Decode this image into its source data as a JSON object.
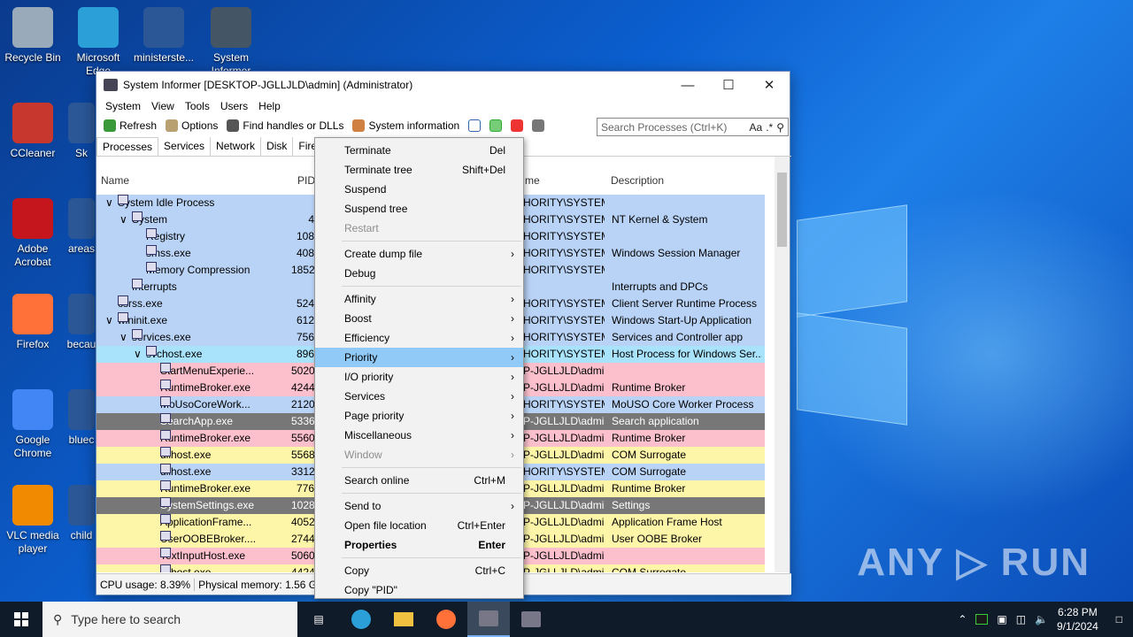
{
  "desktop": {
    "icons": [
      {
        "label": "Recycle Bin",
        "color": "#9ab"
      },
      {
        "label": "Microsoft Edge",
        "color": "#2a9fd8"
      },
      {
        "label": "ministerste...",
        "color": "#2b5797"
      },
      {
        "label": "System Informer",
        "color": "#445566"
      },
      {
        "label": "CCleaner",
        "color": "#c8372d"
      },
      {
        "label": "Adobe Acrobat",
        "color": "#c4161c"
      },
      {
        "label": "Firefox",
        "color": "#ff7139"
      },
      {
        "label": "Google Chrome",
        "color": "#4285f4"
      },
      {
        "label": "VLC media player",
        "color": "#f18a00"
      }
    ],
    "partial_icons": [
      "Sk",
      "areas",
      "becau",
      "bluec",
      "child"
    ],
    "watermark": "ANY ▷ RUN"
  },
  "window": {
    "title": "System Informer [DESKTOP-JGLLJLD\\admin] (Administrator)",
    "menu": [
      "System",
      "View",
      "Tools",
      "Users",
      "Help"
    ],
    "toolbar": {
      "refresh": "Refresh",
      "options": "Options",
      "find": "Find handles or DLLs",
      "sysinfo": "System information"
    },
    "search_placeholder": "Search Processes (Ctrl+K)",
    "search_extra": "Aa",
    "tabs": [
      "Processes",
      "Services",
      "Network",
      "Disk",
      "Fire"
    ],
    "columns": {
      "name": "Name",
      "pid": "PID",
      "user": "me",
      "desc": "Description"
    },
    "rows": [
      {
        "indent": 0,
        "name": "System Idle Process",
        "pid": "",
        "user": "HORITY\\SYSTEM",
        "desc": "",
        "bg": "#b9d3f6",
        "exp": "v"
      },
      {
        "indent": 1,
        "name": "System",
        "pid": "4",
        "user": "HORITY\\SYSTEM",
        "desc": "NT Kernel & System",
        "bg": "#b9d3f6",
        "exp": "v"
      },
      {
        "indent": 2,
        "name": "Registry",
        "pid": "108",
        "user": "HORITY\\SYSTEM",
        "desc": "",
        "bg": "#b9d3f6",
        "exp": ""
      },
      {
        "indent": 2,
        "name": "smss.exe",
        "pid": "408",
        "user": "HORITY\\SYSTEM",
        "desc": "Windows Session Manager",
        "bg": "#b9d3f6",
        "exp": ""
      },
      {
        "indent": 2,
        "name": "Memory Compression",
        "pid": "1852",
        "user": "HORITY\\SYSTEM",
        "desc": "",
        "bg": "#b9d3f6",
        "exp": ""
      },
      {
        "indent": 1,
        "name": "Interrupts",
        "pid": "",
        "user": "",
        "desc": "Interrupts and DPCs",
        "bg": "#b9d3f6",
        "exp": ""
      },
      {
        "indent": 0,
        "name": "csrss.exe",
        "pid": "524",
        "user": "HORITY\\SYSTEM",
        "desc": "Client Server Runtime Process",
        "bg": "#b9d3f6",
        "exp": ""
      },
      {
        "indent": 0,
        "name": "wininit.exe",
        "pid": "612",
        "user": "HORITY\\SYSTEM",
        "desc": "Windows Start-Up Application",
        "bg": "#b9d3f6",
        "exp": "v"
      },
      {
        "indent": 1,
        "name": "services.exe",
        "pid": "756",
        "user": "HORITY\\SYSTEM",
        "desc": "Services and Controller app",
        "bg": "#b9d3f6",
        "exp": "v"
      },
      {
        "indent": 2,
        "name": "svchost.exe",
        "pid": "896",
        "user": "HORITY\\SYSTEM",
        "desc": "Host Process for Windows Ser...",
        "bg": "#a9e3fb",
        "exp": "v"
      },
      {
        "indent": 3,
        "name": "StartMenuExperie...",
        "pid": "5020",
        "user": "P-JGLLJLD\\admi",
        "desc": "",
        "bg": "#fbc0cc",
        "exp": ""
      },
      {
        "indent": 3,
        "name": "RuntimeBroker.exe",
        "pid": "4244",
        "user": "P-JGLLJLD\\admi",
        "desc": "Runtime Broker",
        "bg": "#fbc0cc",
        "exp": ""
      },
      {
        "indent": 3,
        "name": "MoUsoCoreWork...",
        "pid": "2120",
        "user": "HORITY\\SYSTEM",
        "desc": "MoUSO Core Worker Process",
        "bg": "#b9d3f6",
        "exp": ""
      },
      {
        "indent": 3,
        "name": "SearchApp.exe",
        "pid": "5336",
        "user": "P-JGLLJLD\\admi",
        "desc": "Search application",
        "bg": "#777777",
        "fg": "#ffffff",
        "exp": ""
      },
      {
        "indent": 3,
        "name": "RuntimeBroker.exe",
        "pid": "5560",
        "user": "P-JGLLJLD\\admi",
        "desc": "Runtime Broker",
        "bg": "#fbc0cc",
        "exp": ""
      },
      {
        "indent": 3,
        "name": "dllhost.exe",
        "pid": "5568",
        "user": "P-JGLLJLD\\admi",
        "desc": "COM Surrogate",
        "bg": "#fdf5a8",
        "exp": ""
      },
      {
        "indent": 3,
        "name": "dllhost.exe",
        "pid": "3312",
        "user": "HORITY\\SYSTEM",
        "desc": "COM Surrogate",
        "bg": "#b9d3f6",
        "exp": ""
      },
      {
        "indent": 3,
        "name": "RuntimeBroker.exe",
        "pid": "776",
        "user": "P-JGLLJLD\\admi",
        "desc": "Runtime Broker",
        "bg": "#fdf5a8",
        "exp": ""
      },
      {
        "indent": 3,
        "name": "SystemSettings.exe",
        "pid": "1028",
        "user": "P-JGLLJLD\\admi",
        "desc": "Settings",
        "bg": "#777777",
        "fg": "#ffffff",
        "exp": ""
      },
      {
        "indent": 3,
        "name": "ApplicationFrame...",
        "pid": "4052",
        "user": "P-JGLLJLD\\admi",
        "desc": "Application Frame Host",
        "bg": "#fdf5a8",
        "exp": ""
      },
      {
        "indent": 3,
        "name": "UserOOBEBroker....",
        "pid": "2744",
        "user": "P-JGLLJLD\\admi",
        "desc": "User OOBE Broker",
        "bg": "#fdf5a8",
        "exp": ""
      },
      {
        "indent": 3,
        "name": "TextInputHost.exe",
        "pid": "5060",
        "user": "P-JGLLJLD\\admi",
        "desc": "",
        "bg": "#fbc0cc",
        "exp": ""
      },
      {
        "indent": 3,
        "name": "dllhost.exe",
        "pid": "4424",
        "user": "P-JGLLJLD\\admi",
        "desc": "COM Surrogate",
        "bg": "#fdf5a8",
        "exp": ""
      }
    ],
    "status": {
      "cpu": "CPU usage: 8.39%",
      "mem": "Physical memory: 1.56 GB"
    }
  },
  "context_menu": {
    "items": [
      {
        "label": "Terminate",
        "shortcut": "Del"
      },
      {
        "label": "Terminate tree",
        "shortcut": "Shift+Del"
      },
      {
        "label": "Suspend"
      },
      {
        "label": "Suspend tree"
      },
      {
        "label": "Restart",
        "disabled": true
      },
      {
        "sep": true
      },
      {
        "label": "Create dump file",
        "sub": true
      },
      {
        "label": "Debug"
      },
      {
        "sep": true
      },
      {
        "label": "Affinity",
        "sub": true
      },
      {
        "label": "Boost",
        "sub": true
      },
      {
        "label": "Efficiency",
        "sub": true
      },
      {
        "label": "Priority",
        "sub": true,
        "hl": true
      },
      {
        "label": "I/O priority",
        "sub": true
      },
      {
        "label": "Services",
        "sub": true
      },
      {
        "label": "Page priority",
        "sub": true
      },
      {
        "label": "Miscellaneous",
        "sub": true
      },
      {
        "label": "Window",
        "sub": true,
        "disabled": true
      },
      {
        "sep": true
      },
      {
        "label": "Search online",
        "shortcut": "Ctrl+M"
      },
      {
        "sep": true
      },
      {
        "label": "Send to",
        "sub": true
      },
      {
        "label": "Open file location",
        "shortcut": "Ctrl+Enter"
      },
      {
        "label": "Properties",
        "shortcut": "Enter",
        "bold": true
      },
      {
        "sep": true
      },
      {
        "label": "Copy",
        "shortcut": "Ctrl+C"
      },
      {
        "label": "Copy \"PID\""
      }
    ]
  },
  "taskbar": {
    "search_placeholder": "Type here to search",
    "time": "6:28 PM",
    "date": "9/1/2024"
  }
}
